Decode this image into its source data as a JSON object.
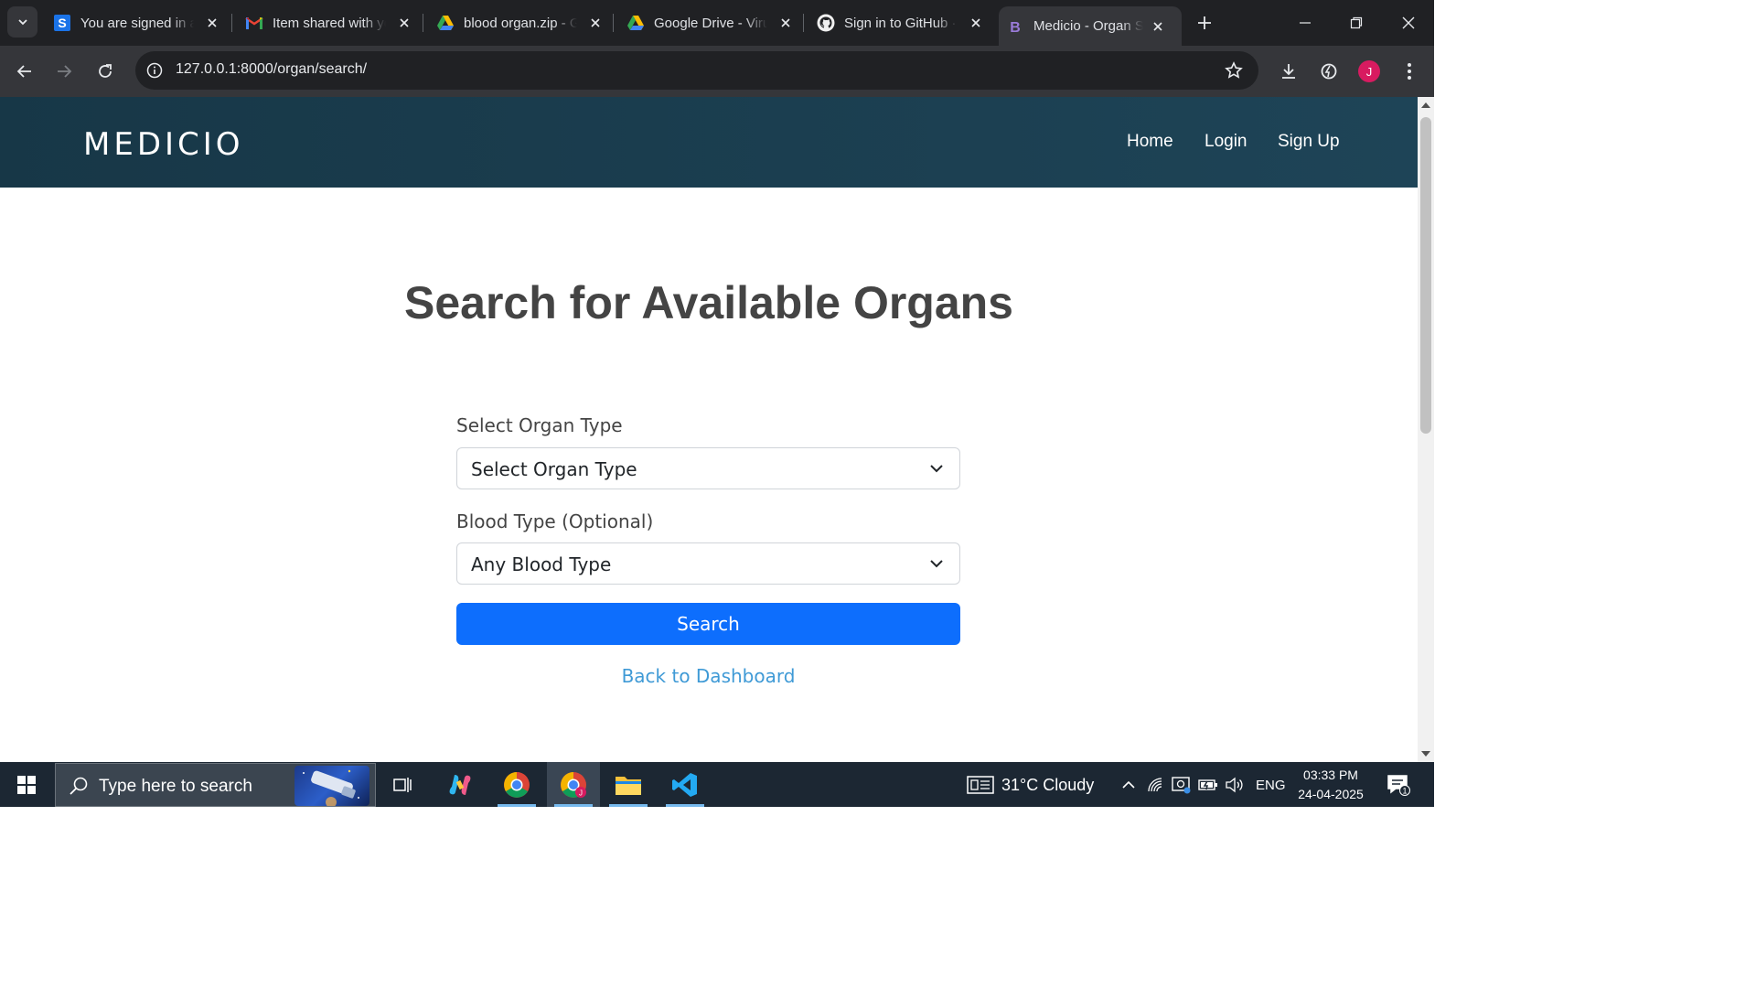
{
  "browser": {
    "tabs": [
      {
        "title": "You are signed in as",
        "icon": "s-logo-icon"
      },
      {
        "title": "Item shared with you",
        "icon": "gmail-icon"
      },
      {
        "title": "blood organ.zip - Google Drive",
        "icon": "google-drive-icon"
      },
      {
        "title": "Google Drive - Virus scan warning",
        "icon": "google-drive-icon"
      },
      {
        "title": "Sign in to GitHub · GitHub",
        "icon": "github-icon"
      },
      {
        "title": "Medicio - Organ Search",
        "icon": "bootstrap-b-icon",
        "active": true
      }
    ],
    "url_host": "127.0.0.1",
    "url_rest": ":8000/organ/search/",
    "profile_initial": "J"
  },
  "site": {
    "brand": "MEDICIO",
    "nav": {
      "home": "Home",
      "login": "Login",
      "signup": "Sign Up"
    }
  },
  "main": {
    "title": "Search for Available Organs",
    "organ_label": "Select Organ Type",
    "organ_value": "Select Organ Type",
    "blood_label": "Blood Type (Optional)",
    "blood_value": "Any Blood Type",
    "search_button": "Search",
    "back_link": "Back to Dashboard"
  },
  "taskbar": {
    "search_placeholder": "Type here to search",
    "weather": "31°C  Cloudy",
    "language": "ENG",
    "time": "03:33 PM",
    "date": "24-04-2025",
    "notification_count": "1"
  }
}
